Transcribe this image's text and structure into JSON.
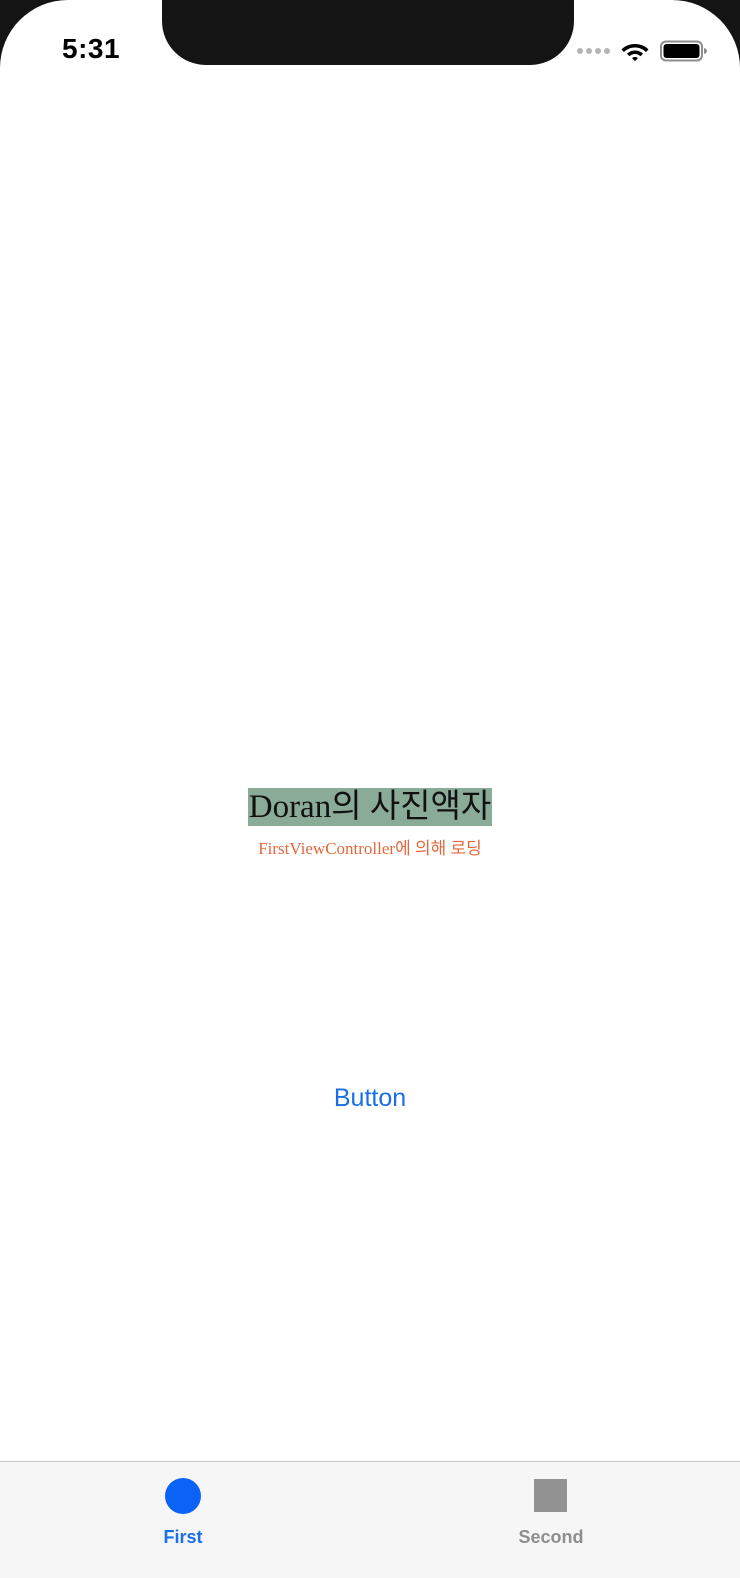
{
  "status_bar": {
    "time": "5:31"
  },
  "main": {
    "title": "Doran의 사진액자",
    "subtitle": "FirstViewController에 의해 로딩",
    "button_label": "Button"
  },
  "tab_bar": {
    "tabs": [
      {
        "label": "First",
        "icon": "circle-icon",
        "selected": true
      },
      {
        "label": "Second",
        "icon": "square-icon",
        "selected": false
      }
    ]
  },
  "colors": {
    "accent": "#1a6fe8",
    "title_highlight": "#8aab98",
    "subtitle_text": "#e3683b",
    "tab_inactive": "#929292"
  }
}
